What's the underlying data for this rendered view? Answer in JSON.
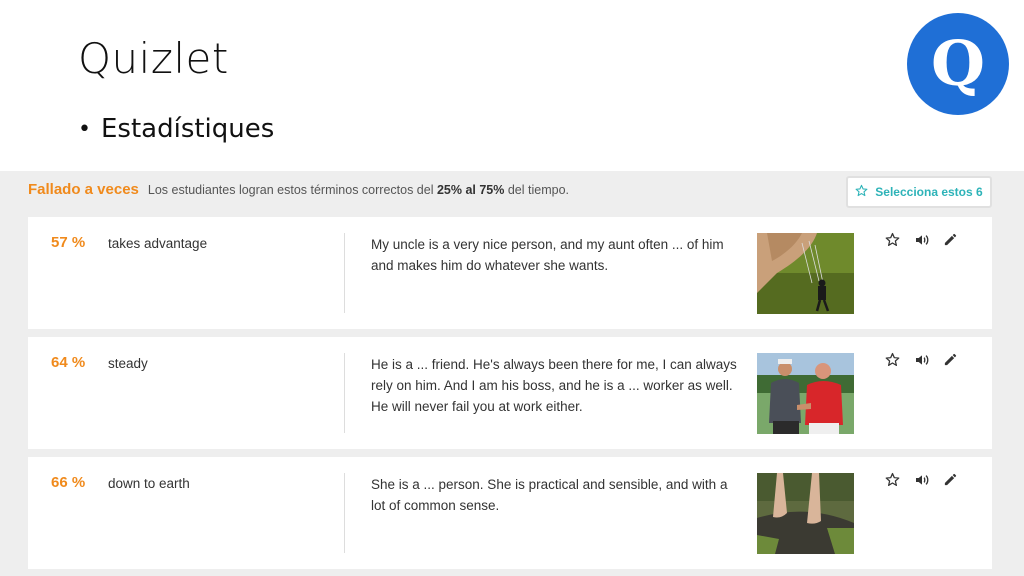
{
  "slide": {
    "title": "Quizlet",
    "bullet": "Estadístiques",
    "logo_letter": "Q"
  },
  "section": {
    "title": "Fallado a veces",
    "desc_prefix": "Los estudiantes logran estos términos correctos del ",
    "desc_bold": "25% al 75%",
    "desc_suffix": " del tiempo.",
    "select_button": "Selecciona estos 6"
  },
  "cards": [
    {
      "percent": "57 %",
      "term": "takes advantage",
      "definition": "My uncle is a very nice person, and my aunt often ... of him and makes him do whatever she wants.",
      "image": "puppet-hand-photo"
    },
    {
      "percent": "64 %",
      "term": "steady",
      "definition": "He is a ... friend. He's always been there for me, I can always rely on him. And I am his boss, and he is a ... worker as well. He will never fail you at work either.",
      "image": "handshake-photo"
    },
    {
      "percent": "66 %",
      "term": "down to earth",
      "definition": "She is a ... person. She is practical and sensible, and with a lot of common sense.",
      "image": "barefoot-on-ground-photo"
    }
  ],
  "icons": [
    "star-icon",
    "speaker-icon",
    "pencil-icon"
  ],
  "colors": {
    "accent_orange": "#f08a1c",
    "teal": "#2db3b8",
    "logo_blue": "#1f6fd6",
    "panel_gray": "#eeeeee"
  }
}
